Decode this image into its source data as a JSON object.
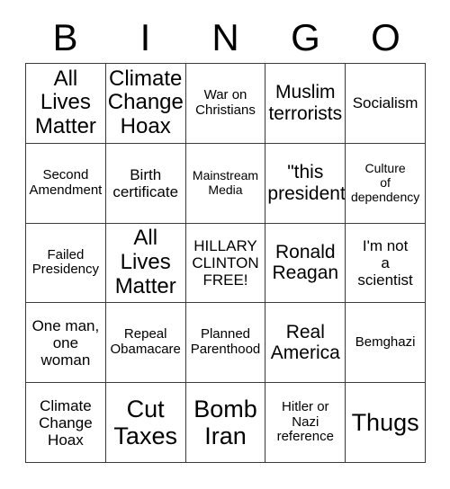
{
  "card": {
    "title": "BINGO",
    "background_color": "#ffffff",
    "text_color": "#000000",
    "border_color": "#3a3a3a"
  },
  "header": {
    "letters": [
      {
        "label": "B"
      },
      {
        "label": "I"
      },
      {
        "label": "N"
      },
      {
        "label": "G"
      },
      {
        "label": "O"
      }
    ]
  },
  "grid": {
    "rows": 5,
    "columns": 5,
    "cells": [
      {
        "text": "All\nLives\nMatter",
        "size": "fs-lg",
        "column": "B",
        "row": 1
      },
      {
        "text": "Climate\nChange\nHoax",
        "size": "fs-lg",
        "column": "I",
        "row": 1
      },
      {
        "text": "War on\nChristians",
        "size": "fs-xs",
        "column": "N",
        "row": 1
      },
      {
        "text": "Muslim\nterrorists",
        "size": "fs-md",
        "column": "G",
        "row": 1
      },
      {
        "text": "Socialism",
        "size": "fs-sm",
        "column": "O",
        "row": 1
      },
      {
        "text": "Second\nAmendment",
        "size": "fs-xs",
        "column": "B",
        "row": 2
      },
      {
        "text": "Birth\ncertificate",
        "size": "fs-sm",
        "column": "I",
        "row": 2
      },
      {
        "text": "Mainstream\nMedia",
        "size": "fs-xxs",
        "column": "N",
        "row": 2
      },
      {
        "text": "\"this\npresident\"",
        "size": "fs-md",
        "column": "G",
        "row": 2
      },
      {
        "text": "Culture\nof\ndependency",
        "size": "fs-xxs",
        "column": "O",
        "row": 2
      },
      {
        "text": "Failed\nPresidency",
        "size": "fs-xs",
        "column": "B",
        "row": 3
      },
      {
        "text": "All\nLives\nMatter",
        "size": "fs-lg",
        "column": "I",
        "row": 3
      },
      {
        "text": "HILLARY\nCLINTON\nFREE!",
        "size": "fs-sm",
        "column": "N",
        "row": 3
      },
      {
        "text": "Ronald\nReagan",
        "size": "fs-md",
        "column": "G",
        "row": 3
      },
      {
        "text": "I'm not\na\nscientist",
        "size": "fs-sm",
        "column": "O",
        "row": 3
      },
      {
        "text": "One man,\none\nwoman",
        "size": "fs-sm",
        "column": "B",
        "row": 4
      },
      {
        "text": "Repeal\nObamacare",
        "size": "fs-xs",
        "column": "I",
        "row": 4
      },
      {
        "text": "Planned\nParenthood",
        "size": "fs-xs",
        "column": "N",
        "row": 4
      },
      {
        "text": "Real\nAmerica",
        "size": "fs-md",
        "column": "G",
        "row": 4
      },
      {
        "text": "Bemghazi",
        "size": "fs-xs",
        "column": "O",
        "row": 4
      },
      {
        "text": "Climate\nChange\nHoax",
        "size": "fs-sm",
        "column": "B",
        "row": 5
      },
      {
        "text": "Cut\nTaxes",
        "size": "fs-xl",
        "column": "I",
        "row": 5
      },
      {
        "text": "Bomb\nIran",
        "size": "fs-xl",
        "column": "N",
        "row": 5
      },
      {
        "text": "Hitler or\nNazi\nreference",
        "size": "fs-xs",
        "column": "G",
        "row": 5
      },
      {
        "text": "Thugs",
        "size": "fs-xl",
        "column": "O",
        "row": 5
      }
    ]
  }
}
